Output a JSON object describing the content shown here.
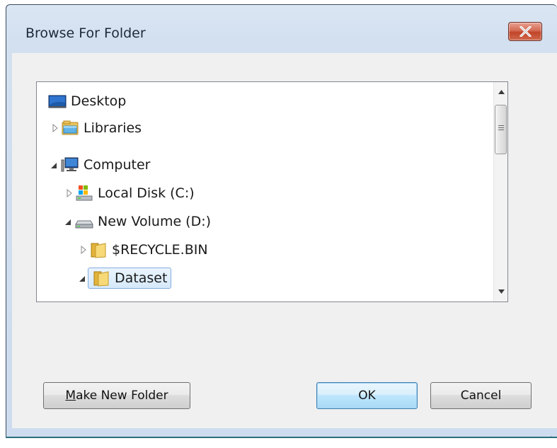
{
  "dialog": {
    "title": "Browse For Folder",
    "close_label": "Close"
  },
  "tree": {
    "items": [
      {
        "label": "Desktop",
        "icon": "desktop-icon",
        "expander": "none"
      },
      {
        "label": "Libraries",
        "icon": "libraries-icon",
        "expander": "collapsed"
      },
      {
        "label": "Computer",
        "icon": "computer-icon",
        "expander": "expanded"
      },
      {
        "label": "Local Disk (C:)",
        "icon": "system-drive-icon",
        "expander": "collapsed"
      },
      {
        "label": "New Volume (D:)",
        "icon": "drive-icon",
        "expander": "expanded"
      },
      {
        "label": "$RECYCLE.BIN",
        "icon": "folder-icon",
        "expander": "collapsed"
      },
      {
        "label": "Dataset",
        "icon": "folder-icon",
        "expander": "expanded",
        "selected": true
      }
    ]
  },
  "buttons": {
    "make_new_folder_accel": "M",
    "make_new_folder_rest": "ake New Folder",
    "ok": "OK",
    "cancel": "Cancel"
  }
}
